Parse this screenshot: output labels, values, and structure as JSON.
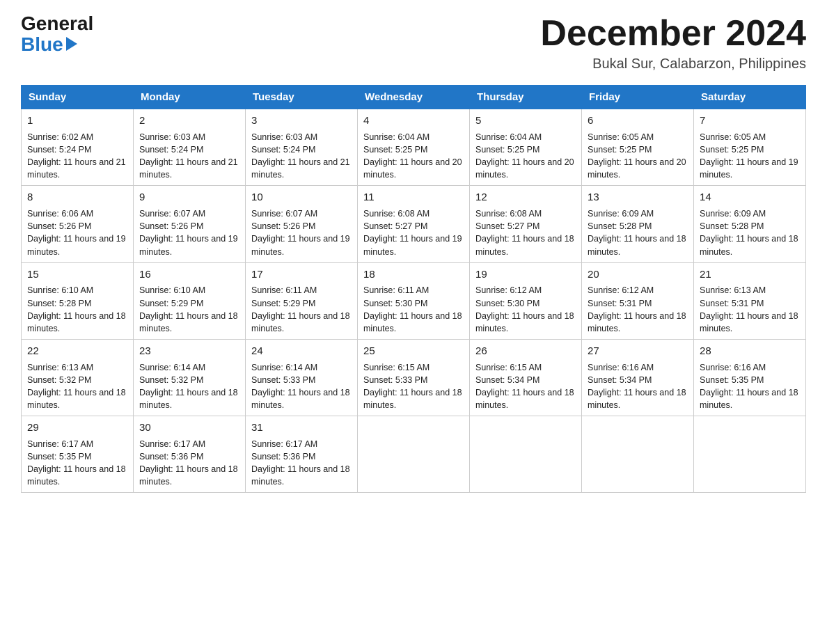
{
  "header": {
    "logo_general": "General",
    "logo_blue": "Blue",
    "month_title": "December 2024",
    "subtitle": "Bukal Sur, Calabarzon, Philippines"
  },
  "days_of_week": [
    "Sunday",
    "Monday",
    "Tuesday",
    "Wednesday",
    "Thursday",
    "Friday",
    "Saturday"
  ],
  "weeks": [
    [
      {
        "day": "1",
        "sunrise": "6:02 AM",
        "sunset": "5:24 PM",
        "daylight": "11 hours and 21 minutes."
      },
      {
        "day": "2",
        "sunrise": "6:03 AM",
        "sunset": "5:24 PM",
        "daylight": "11 hours and 21 minutes."
      },
      {
        "day": "3",
        "sunrise": "6:03 AM",
        "sunset": "5:24 PM",
        "daylight": "11 hours and 21 minutes."
      },
      {
        "day": "4",
        "sunrise": "6:04 AM",
        "sunset": "5:25 PM",
        "daylight": "11 hours and 20 minutes."
      },
      {
        "day": "5",
        "sunrise": "6:04 AM",
        "sunset": "5:25 PM",
        "daylight": "11 hours and 20 minutes."
      },
      {
        "day": "6",
        "sunrise": "6:05 AM",
        "sunset": "5:25 PM",
        "daylight": "11 hours and 20 minutes."
      },
      {
        "day": "7",
        "sunrise": "6:05 AM",
        "sunset": "5:25 PM",
        "daylight": "11 hours and 19 minutes."
      }
    ],
    [
      {
        "day": "8",
        "sunrise": "6:06 AM",
        "sunset": "5:26 PM",
        "daylight": "11 hours and 19 minutes."
      },
      {
        "day": "9",
        "sunrise": "6:07 AM",
        "sunset": "5:26 PM",
        "daylight": "11 hours and 19 minutes."
      },
      {
        "day": "10",
        "sunrise": "6:07 AM",
        "sunset": "5:26 PM",
        "daylight": "11 hours and 19 minutes."
      },
      {
        "day": "11",
        "sunrise": "6:08 AM",
        "sunset": "5:27 PM",
        "daylight": "11 hours and 19 minutes."
      },
      {
        "day": "12",
        "sunrise": "6:08 AM",
        "sunset": "5:27 PM",
        "daylight": "11 hours and 18 minutes."
      },
      {
        "day": "13",
        "sunrise": "6:09 AM",
        "sunset": "5:28 PM",
        "daylight": "11 hours and 18 minutes."
      },
      {
        "day": "14",
        "sunrise": "6:09 AM",
        "sunset": "5:28 PM",
        "daylight": "11 hours and 18 minutes."
      }
    ],
    [
      {
        "day": "15",
        "sunrise": "6:10 AM",
        "sunset": "5:28 PM",
        "daylight": "11 hours and 18 minutes."
      },
      {
        "day": "16",
        "sunrise": "6:10 AM",
        "sunset": "5:29 PM",
        "daylight": "11 hours and 18 minutes."
      },
      {
        "day": "17",
        "sunrise": "6:11 AM",
        "sunset": "5:29 PM",
        "daylight": "11 hours and 18 minutes."
      },
      {
        "day": "18",
        "sunrise": "6:11 AM",
        "sunset": "5:30 PM",
        "daylight": "11 hours and 18 minutes."
      },
      {
        "day": "19",
        "sunrise": "6:12 AM",
        "sunset": "5:30 PM",
        "daylight": "11 hours and 18 minutes."
      },
      {
        "day": "20",
        "sunrise": "6:12 AM",
        "sunset": "5:31 PM",
        "daylight": "11 hours and 18 minutes."
      },
      {
        "day": "21",
        "sunrise": "6:13 AM",
        "sunset": "5:31 PM",
        "daylight": "11 hours and 18 minutes."
      }
    ],
    [
      {
        "day": "22",
        "sunrise": "6:13 AM",
        "sunset": "5:32 PM",
        "daylight": "11 hours and 18 minutes."
      },
      {
        "day": "23",
        "sunrise": "6:14 AM",
        "sunset": "5:32 PM",
        "daylight": "11 hours and 18 minutes."
      },
      {
        "day": "24",
        "sunrise": "6:14 AM",
        "sunset": "5:33 PM",
        "daylight": "11 hours and 18 minutes."
      },
      {
        "day": "25",
        "sunrise": "6:15 AM",
        "sunset": "5:33 PM",
        "daylight": "11 hours and 18 minutes."
      },
      {
        "day": "26",
        "sunrise": "6:15 AM",
        "sunset": "5:34 PM",
        "daylight": "11 hours and 18 minutes."
      },
      {
        "day": "27",
        "sunrise": "6:16 AM",
        "sunset": "5:34 PM",
        "daylight": "11 hours and 18 minutes."
      },
      {
        "day": "28",
        "sunrise": "6:16 AM",
        "sunset": "5:35 PM",
        "daylight": "11 hours and 18 minutes."
      }
    ],
    [
      {
        "day": "29",
        "sunrise": "6:17 AM",
        "sunset": "5:35 PM",
        "daylight": "11 hours and 18 minutes."
      },
      {
        "day": "30",
        "sunrise": "6:17 AM",
        "sunset": "5:36 PM",
        "daylight": "11 hours and 18 minutes."
      },
      {
        "day": "31",
        "sunrise": "6:17 AM",
        "sunset": "5:36 PM",
        "daylight": "11 hours and 18 minutes."
      },
      {
        "day": "",
        "sunrise": "",
        "sunset": "",
        "daylight": ""
      },
      {
        "day": "",
        "sunrise": "",
        "sunset": "",
        "daylight": ""
      },
      {
        "day": "",
        "sunrise": "",
        "sunset": "",
        "daylight": ""
      },
      {
        "day": "",
        "sunrise": "",
        "sunset": "",
        "daylight": ""
      }
    ]
  ]
}
